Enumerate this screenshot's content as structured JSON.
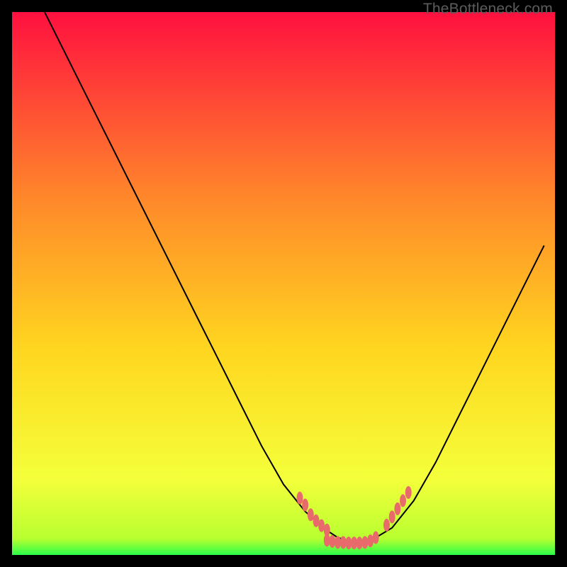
{
  "watermark": "TheBottleneck.com",
  "colors": {
    "background": "#000000",
    "gradient_top": "#ff103f",
    "gradient_mid1": "#ff6a2b",
    "gradient_mid2": "#ffd61f",
    "gradient_mid3": "#f8ff1f",
    "gradient_bottom": "#2aff4a",
    "curve": "#000000",
    "dots": "#e86a6a",
    "watermark": "#5c5c5c"
  },
  "chart_data": {
    "type": "line",
    "title": "",
    "xlabel": "",
    "ylabel": "",
    "xlim": [
      0,
      100
    ],
    "ylim": [
      0,
      100
    ],
    "series": [
      {
        "name": "bottleneck-curve",
        "x": [
          6,
          10,
          14,
          18,
          22,
          26,
          30,
          34,
          38,
          42,
          46,
          50,
          54,
          58,
          60,
          62,
          64,
          66,
          70,
          74,
          78,
          82,
          86,
          90,
          94,
          98
        ],
        "values": [
          100,
          92,
          84,
          76,
          68,
          60,
          52,
          44,
          36,
          28,
          20,
          13,
          8,
          4.5,
          3.2,
          2.6,
          2.4,
          2.6,
          5,
          10,
          17,
          25,
          33,
          41,
          49,
          57
        ]
      }
    ],
    "dot_clusters": [
      {
        "name": "left-descent-dots",
        "points": [
          {
            "x": 53,
            "y": 10.5
          },
          {
            "x": 54,
            "y": 9.2
          },
          {
            "x": 55,
            "y": 7.4
          },
          {
            "x": 56,
            "y": 6.3
          },
          {
            "x": 57,
            "y": 5.4
          },
          {
            "x": 58,
            "y": 4.6
          }
        ]
      },
      {
        "name": "valley-dots",
        "points": [
          {
            "x": 58,
            "y": 2.7
          },
          {
            "x": 59,
            "y": 2.5
          },
          {
            "x": 60,
            "y": 2.3
          },
          {
            "x": 61,
            "y": 2.3
          },
          {
            "x": 62,
            "y": 2.2
          },
          {
            "x": 63,
            "y": 2.2
          },
          {
            "x": 64,
            "y": 2.2
          },
          {
            "x": 65,
            "y": 2.3
          },
          {
            "x": 66,
            "y": 2.6
          },
          {
            "x": 67,
            "y": 3.2
          }
        ]
      },
      {
        "name": "right-ascent-dots",
        "points": [
          {
            "x": 69,
            "y": 5.5
          },
          {
            "x": 70,
            "y": 7.0
          },
          {
            "x": 71,
            "y": 8.5
          },
          {
            "x": 72,
            "y": 10.0
          },
          {
            "x": 73,
            "y": 11.5
          }
        ]
      }
    ]
  }
}
